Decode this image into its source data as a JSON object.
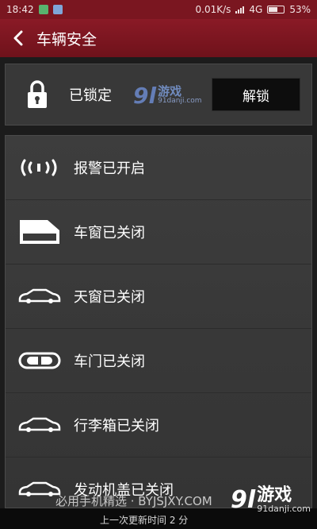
{
  "status_bar": {
    "time": "18:42",
    "network_speed": "0.01K/s",
    "network_type": "4G",
    "battery": "53%"
  },
  "header": {
    "back_icon": "chevron-left-icon",
    "title": "车辆安全"
  },
  "lock": {
    "icon": "padlock-icon",
    "status": "已锁定",
    "unlock_label": "解锁"
  },
  "watermark": {
    "logo": "9l",
    "main": "游戏",
    "sub": "91danji.com"
  },
  "items": [
    {
      "icon": "alarm-signal-icon",
      "label": "报警已开启"
    },
    {
      "icon": "car-window-icon",
      "label": "车窗已关闭"
    },
    {
      "icon": "car-sunroof-icon",
      "label": "天窗已关闭"
    },
    {
      "icon": "car-door-icon",
      "label": "车门已关闭"
    },
    {
      "icon": "car-trunk-icon",
      "label": "行李箱已关闭"
    },
    {
      "icon": "car-hood-icon",
      "label": "发动机盖已关闭"
    }
  ],
  "footer": {
    "update_text": "上一次更新时间 2 分",
    "ad_text": "必用手机精选 · BYJSJXY.COM",
    "logo": "9l",
    "logo_main": "游戏",
    "logo_sub": "91danji.com"
  }
}
